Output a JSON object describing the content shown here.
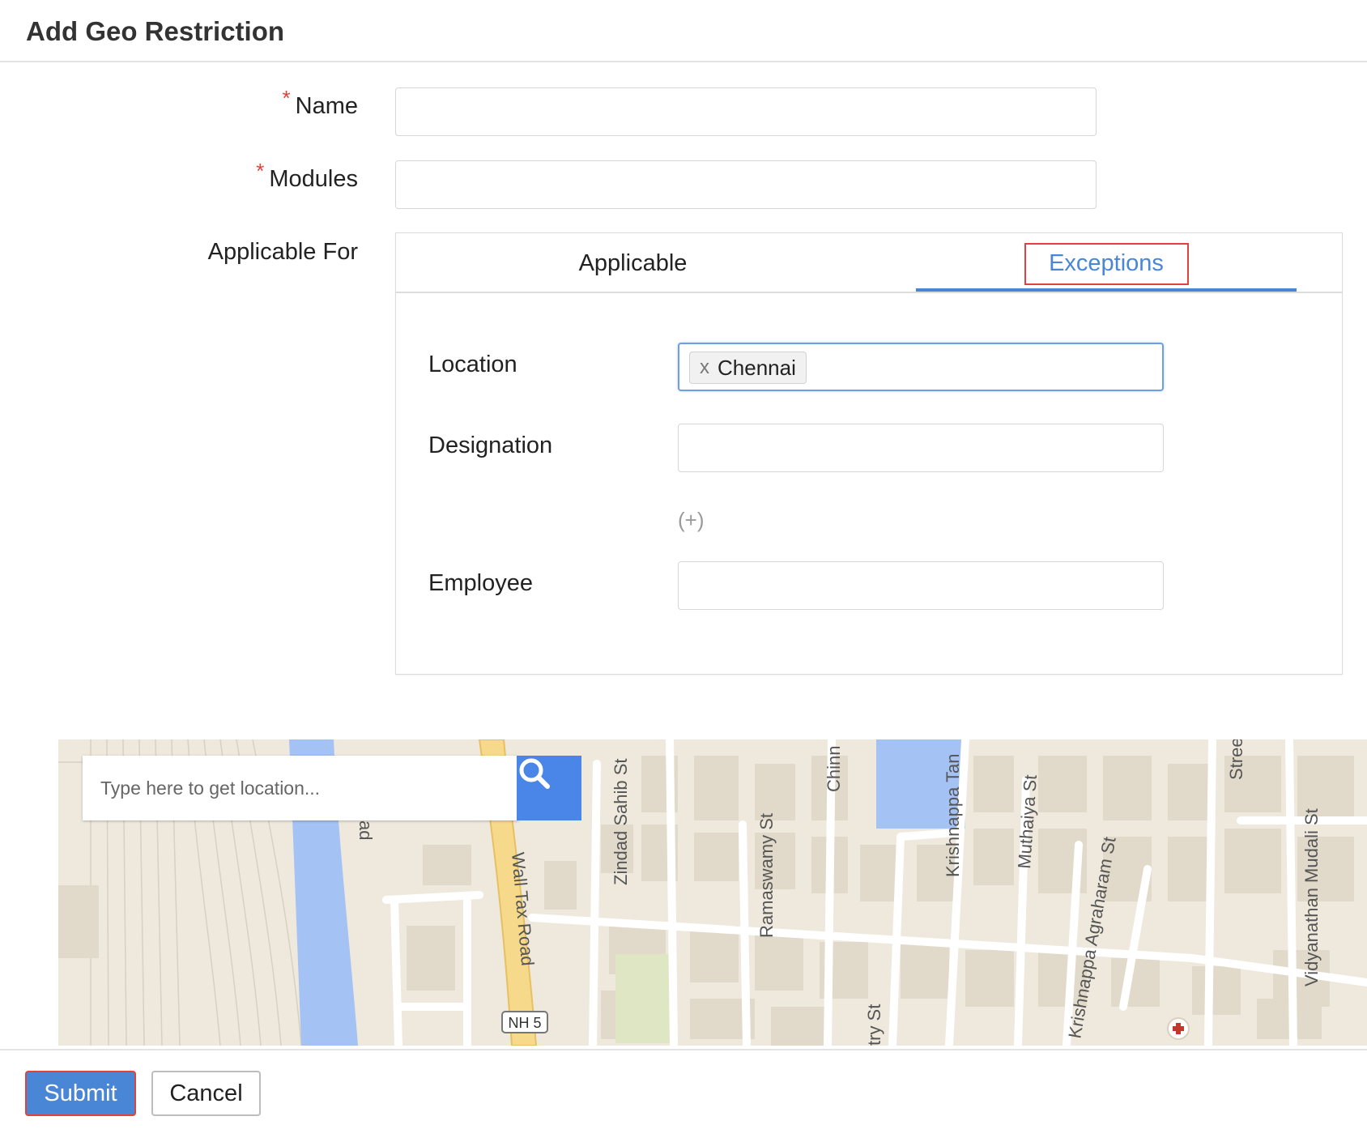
{
  "header": {
    "title": "Add Geo Restriction"
  },
  "form": {
    "required_mark": "*",
    "name_label": "Name",
    "name_value": "",
    "modules_label": "Modules",
    "modules_value": "",
    "applicable_for_label": "Applicable For"
  },
  "tabs": {
    "applicable_label": "Applicable",
    "exceptions_label": "Exceptions",
    "active": "Exceptions"
  },
  "exceptions": {
    "location_label": "Location",
    "location_tags": [
      {
        "remove": "x",
        "label": "Chennai"
      }
    ],
    "designation_label": "Designation",
    "designation_value": "",
    "add_more_label": "(+)",
    "employee_label": "Employee",
    "employee_value": ""
  },
  "map": {
    "search_placeholder": "Type here to get location...",
    "labels": {
      "road_1": "Wall Tax Road",
      "road_2": "Zindad Sahib St",
      "road_3": "Ramaswamy St",
      "road_4": "Chinn",
      "road_5": "Krishnappa Tan",
      "road_6": "Muthaiya St",
      "road_7": "Krishnappa Agraharam St",
      "road_8": "Vidyanathan Mudali St",
      "road_9": "Street",
      "road_10": "ad",
      "road_11": "try St",
      "highway_shield": "NH 5"
    },
    "colors": {
      "water": "#a4c2f4",
      "land": "#efe9dd",
      "building": "#e1d9c9",
      "road": "#ffffff",
      "highway": "#f6d98a"
    }
  },
  "footer": {
    "submit_label": "Submit",
    "cancel_label": "Cancel"
  },
  "colors": {
    "accent": "#4a86d6",
    "highlight": "#e0433b",
    "required": "#e0433b"
  },
  "icons": {
    "search": "search-icon",
    "tag_remove": "close-icon",
    "map_pin": "medical-cross-icon"
  }
}
